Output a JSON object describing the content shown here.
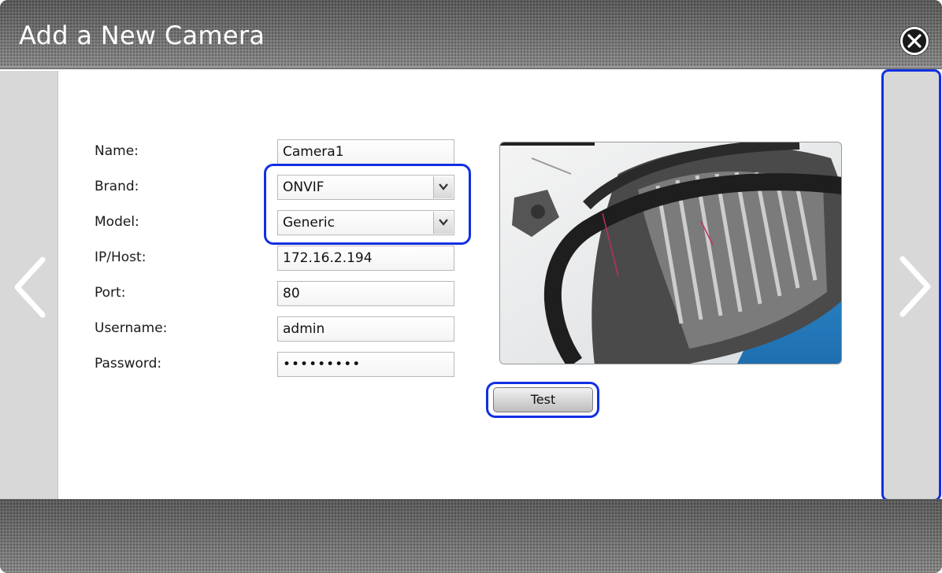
{
  "dialog": {
    "title": "Add a New Camera",
    "close_icon": "close-circle-icon"
  },
  "nav": {
    "prev_icon": "chevron-left-icon",
    "next_icon": "chevron-right-icon"
  },
  "form": {
    "name_label": "Name:",
    "name_value": "Camera1",
    "brand_label": "Brand:",
    "brand_value": "ONVIF",
    "model_label": "Model:",
    "model_value": "Generic",
    "ip_label": "IP/Host:",
    "ip_value": "172.16.2.194",
    "port_label": "Port:",
    "port_value": "80",
    "username_label": "Username:",
    "username_value": "admin",
    "password_label": "Password:",
    "password_value": "•••••••••"
  },
  "preview": {
    "test_button_label": "Test"
  },
  "colors": {
    "highlight": "#1030e0",
    "chrome": "#6e6e6e",
    "side_panel": "#d8d8d8"
  }
}
